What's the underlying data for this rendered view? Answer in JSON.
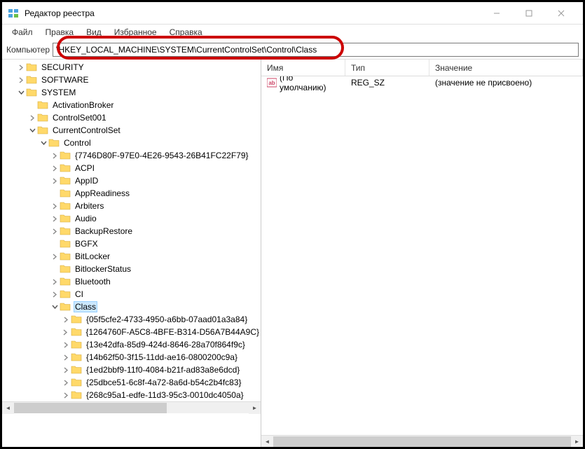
{
  "window": {
    "title": "Редактор реестра"
  },
  "menubar": {
    "file": "Файл",
    "edit": "Правка",
    "view": "Вид",
    "favorites": "Избранное",
    "help": "Справка"
  },
  "addressbar": {
    "label": "Компьютер",
    "path": "\\HKEY_LOCAL_MACHINE\\SYSTEM\\CurrentControlSet\\Control\\Class"
  },
  "columns": {
    "name": "Имя",
    "type": "Тип",
    "value": "Значение"
  },
  "values": [
    {
      "name": "(По умолчанию)",
      "type": "REG_SZ",
      "data": "(значение не присвоено)"
    }
  ],
  "tree": [
    {
      "label": "SECURITY",
      "depth": 1,
      "exp": "closed"
    },
    {
      "label": "SOFTWARE",
      "depth": 1,
      "exp": "closed"
    },
    {
      "label": "SYSTEM",
      "depth": 1,
      "exp": "open"
    },
    {
      "label": "ActivationBroker",
      "depth": 2,
      "exp": "none"
    },
    {
      "label": "ControlSet001",
      "depth": 2,
      "exp": "closed"
    },
    {
      "label": "CurrentControlSet",
      "depth": 2,
      "exp": "open"
    },
    {
      "label": "Control",
      "depth": 3,
      "exp": "open"
    },
    {
      "label": "{7746D80F-97E0-4E26-9543-26B41FC22F79}",
      "depth": 4,
      "exp": "closed"
    },
    {
      "label": "ACPI",
      "depth": 4,
      "exp": "closed"
    },
    {
      "label": "AppID",
      "depth": 4,
      "exp": "closed"
    },
    {
      "label": "AppReadiness",
      "depth": 4,
      "exp": "none"
    },
    {
      "label": "Arbiters",
      "depth": 4,
      "exp": "closed"
    },
    {
      "label": "Audio",
      "depth": 4,
      "exp": "closed"
    },
    {
      "label": "BackupRestore",
      "depth": 4,
      "exp": "closed"
    },
    {
      "label": "BGFX",
      "depth": 4,
      "exp": "none"
    },
    {
      "label": "BitLocker",
      "depth": 4,
      "exp": "closed"
    },
    {
      "label": "BitlockerStatus",
      "depth": 4,
      "exp": "none"
    },
    {
      "label": "Bluetooth",
      "depth": 4,
      "exp": "closed"
    },
    {
      "label": "CI",
      "depth": 4,
      "exp": "closed"
    },
    {
      "label": "Class",
      "depth": 4,
      "exp": "open",
      "selected": true
    },
    {
      "label": "{05f5cfe2-4733-4950-a6bb-07aad01a3a84}",
      "depth": 5,
      "exp": "closed"
    },
    {
      "label": "{1264760F-A5C8-4BFE-B314-D56A7B44A9C}",
      "depth": 5,
      "exp": "closed"
    },
    {
      "label": "{13e42dfa-85d9-424d-8646-28a70f864f9c}",
      "depth": 5,
      "exp": "closed"
    },
    {
      "label": "{14b62f50-3f15-11dd-ae16-0800200c9a}",
      "depth": 5,
      "exp": "closed"
    },
    {
      "label": "{1ed2bbf9-11f0-4084-b21f-ad83a8e6dcd}",
      "depth": 5,
      "exp": "closed"
    },
    {
      "label": "{25dbce51-6c8f-4a72-8a6d-b54c2b4fc83}",
      "depth": 5,
      "exp": "closed"
    },
    {
      "label": "{268c95a1-edfe-11d3-95c3-0010dc4050a}",
      "depth": 5,
      "exp": "closed"
    }
  ]
}
